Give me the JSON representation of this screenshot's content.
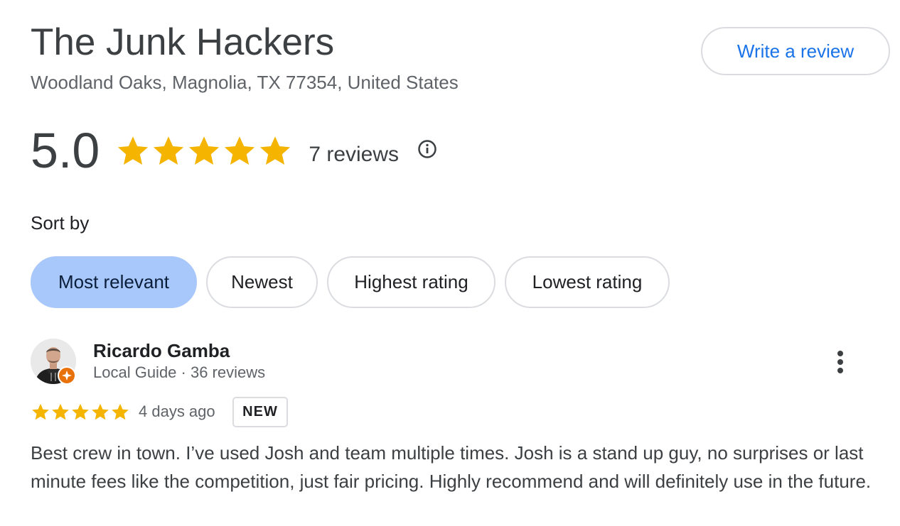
{
  "business": {
    "name": "The Junk Hackers",
    "address": "Woodland Oaks, Magnolia, TX 77354, United States"
  },
  "actions": {
    "write_review_label": "Write a review"
  },
  "summary": {
    "rating": "5.0",
    "stars": 5,
    "review_count": "7 reviews",
    "info_icon": "info-icon",
    "star_color": "#f4b400"
  },
  "sort": {
    "label": "Sort by",
    "options": [
      {
        "label": "Most relevant",
        "selected": true
      },
      {
        "label": "Newest",
        "selected": false
      },
      {
        "label": "Highest rating",
        "selected": false
      },
      {
        "label": "Lowest rating",
        "selected": false
      }
    ],
    "selected_color": "#a8c7fa"
  },
  "reviews": [
    {
      "author": "Ricardo Gamba",
      "meta": "Local Guide · 36 reviews",
      "stars": 5,
      "date": "4 days ago",
      "badge": "NEW",
      "text": "Best crew in town. I’ve used Josh and team multiple times. Josh is a stand up guy, no surprises or last minute fees like the competition, just fair pricing. Highly recommend and will definitely use in the future.",
      "avatar_icon": "avatar",
      "guide_badge_icon": "local-guide-badge-icon",
      "menu_icon": "more-vert-icon"
    }
  ]
}
